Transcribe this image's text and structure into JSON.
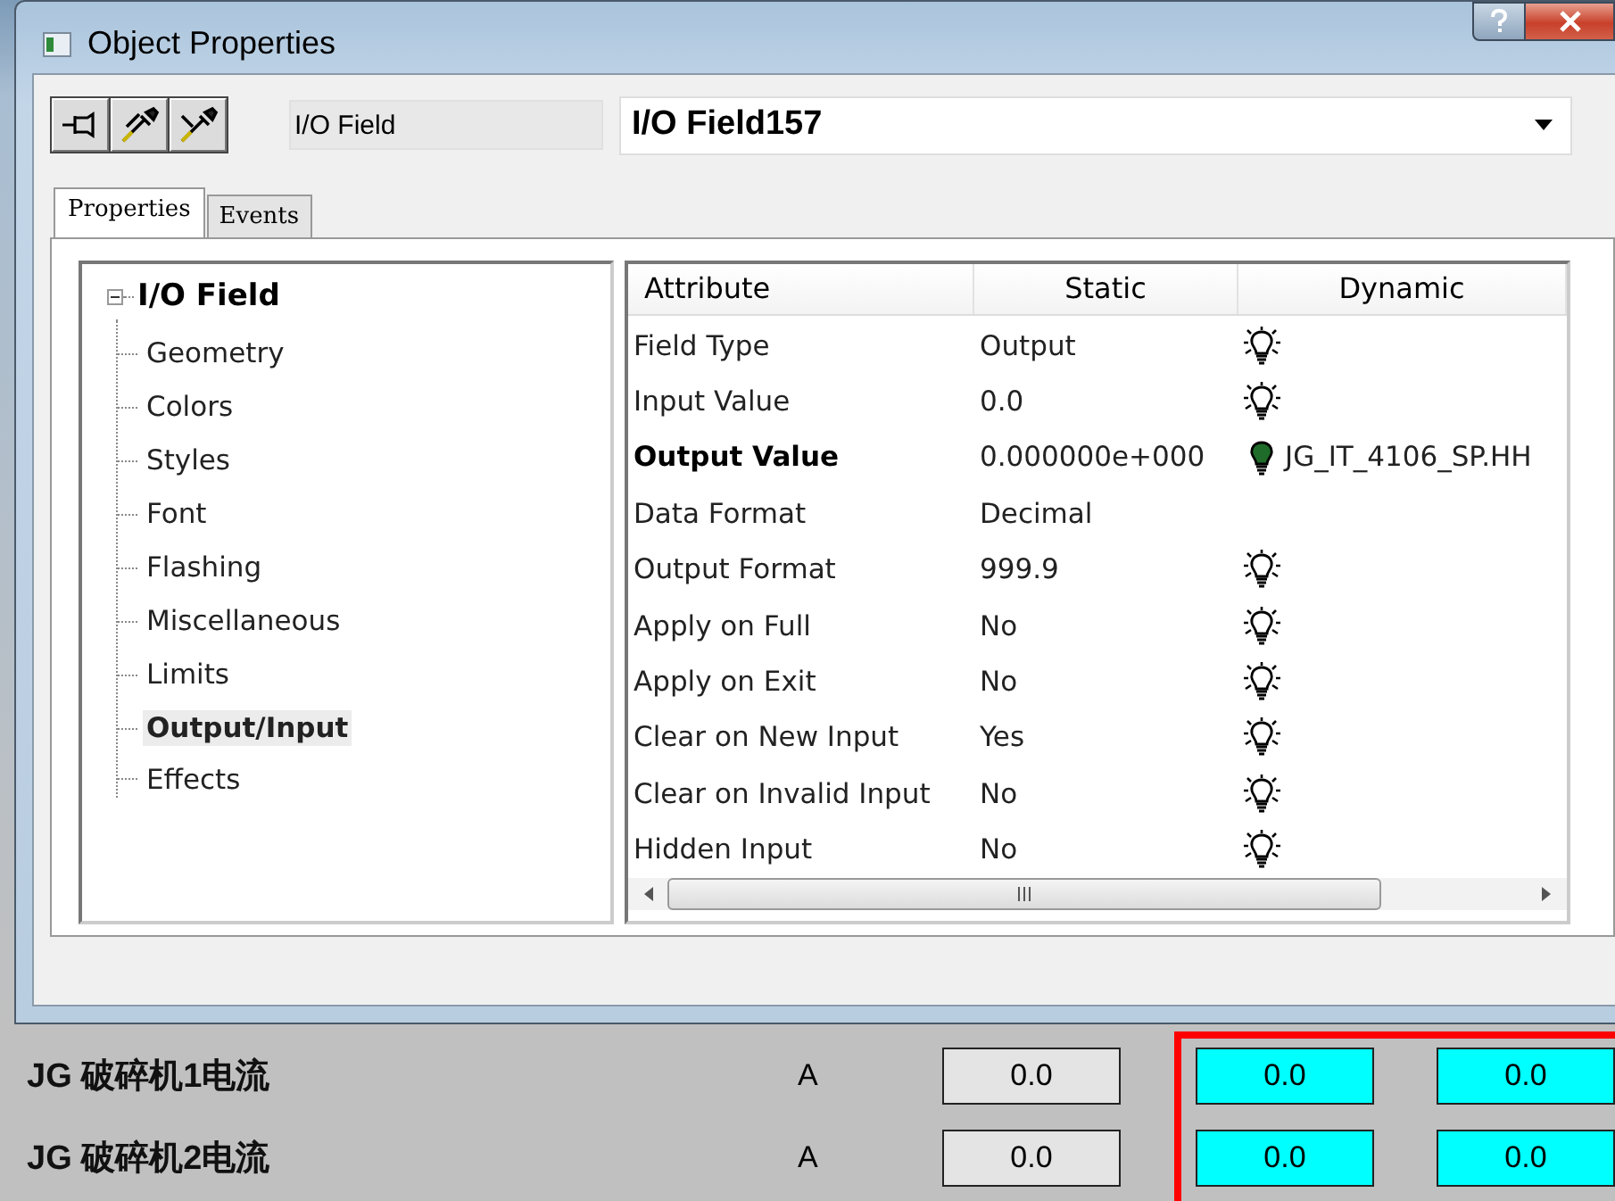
{
  "window": {
    "title": "Object Properties"
  },
  "toolbar": {
    "type_label": "I/O Field",
    "object_name": "I/O Field157"
  },
  "tabs": [
    {
      "label": "Properties",
      "selected": true
    },
    {
      "label": "Events",
      "selected": false
    }
  ],
  "tree": {
    "label": "I/O Field",
    "expanded": true,
    "children": [
      {
        "label": "Geometry",
        "selected": false
      },
      {
        "label": "Colors",
        "selected": false
      },
      {
        "label": "Styles",
        "selected": false
      },
      {
        "label": "Font",
        "selected": false
      },
      {
        "label": "Flashing",
        "selected": false
      },
      {
        "label": "Miscellaneous",
        "selected": false
      },
      {
        "label": "Limits",
        "selected": false
      },
      {
        "label": "Output/Input",
        "selected": true
      },
      {
        "label": "Effects",
        "selected": false
      }
    ]
  },
  "table": {
    "columns": [
      "Attribute",
      "Static",
      "Dynamic"
    ],
    "rows": [
      {
        "attribute": "Field Type",
        "static": "Output",
        "bold": false,
        "dynamic": {
          "kind": "lamp-off"
        }
      },
      {
        "attribute": "Input Value",
        "static": "0.0",
        "bold": false,
        "dynamic": {
          "kind": "lamp-off"
        }
      },
      {
        "attribute": "Output Value",
        "static": "0.000000e+000",
        "bold": true,
        "dynamic": {
          "kind": "lamp-on",
          "text": "JG_IT_4106_SP.HH"
        }
      },
      {
        "attribute": "Data Format",
        "static": "Decimal",
        "bold": false,
        "dynamic": {
          "kind": "none"
        }
      },
      {
        "attribute": "Output Format",
        "static": "999.9",
        "bold": false,
        "dynamic": {
          "kind": "lamp-off"
        }
      },
      {
        "attribute": "Apply on Full",
        "static": "No",
        "bold": false,
        "dynamic": {
          "kind": "lamp-off"
        }
      },
      {
        "attribute": "Apply on Exit",
        "static": "No",
        "bold": false,
        "dynamic": {
          "kind": "lamp-off"
        }
      },
      {
        "attribute": "Clear on New Input",
        "static": "Yes",
        "bold": false,
        "dynamic": {
          "kind": "lamp-off"
        }
      },
      {
        "attribute": "Clear on Invalid Input",
        "static": "No",
        "bold": false,
        "dynamic": {
          "kind": "lamp-off"
        }
      },
      {
        "attribute": "Hidden Input",
        "static": "No",
        "bold": false,
        "dynamic": {
          "kind": "lamp-off"
        }
      }
    ]
  },
  "readouts": [
    {
      "label": "JG 破碎机1电流",
      "unit": "A",
      "value": "0.0",
      "limits": [
        "0.0",
        "0.0"
      ]
    },
    {
      "label": "JG 破碎机2电流",
      "unit": "A",
      "value": "0.0",
      "limits": [
        "0.0",
        "0.0"
      ]
    }
  ]
}
